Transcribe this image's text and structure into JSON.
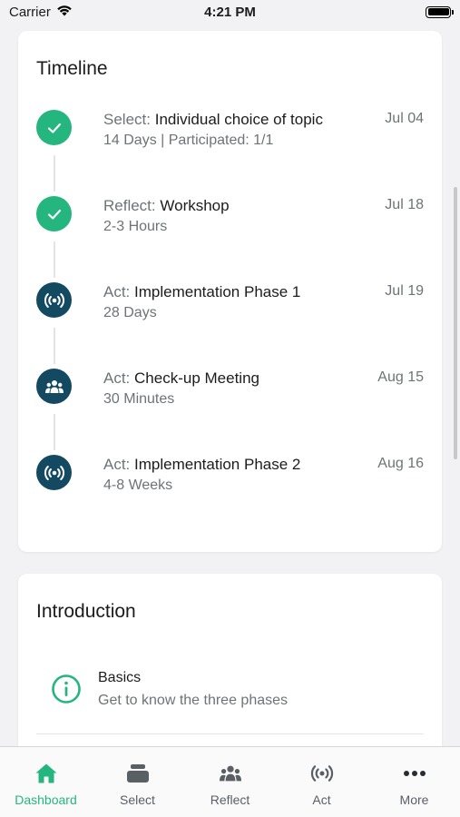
{
  "status_bar": {
    "carrier": "Carrier",
    "time": "4:21 PM"
  },
  "colors": {
    "accent": "#25b67f",
    "act": "#134a62",
    "muted": "#6e7378"
  },
  "timeline": {
    "title": "Timeline",
    "items": [
      {
        "phase": "Select:",
        "name": "Individual choice of topic",
        "sub": "14 Days | Participated: 1/1",
        "date": "Jul 04",
        "icon": "check-icon",
        "state": "done"
      },
      {
        "phase": "Reflect:",
        "name": "Workshop",
        "sub": "2-3 Hours",
        "date": "Jul 18",
        "icon": "check-icon",
        "state": "done"
      },
      {
        "phase": "Act:",
        "name": "Implementation Phase 1",
        "sub": "28 Days",
        "date": "Jul 19",
        "icon": "broadcast-icon",
        "state": "act"
      },
      {
        "phase": "Act:",
        "name": "Check-up Meeting",
        "sub": "30 Minutes",
        "date": "Aug 15",
        "icon": "group-icon",
        "state": "act"
      },
      {
        "phase": "Act:",
        "name": "Implementation Phase 2",
        "sub": "4-8 Weeks",
        "date": "Aug 16",
        "icon": "broadcast-icon",
        "state": "act"
      }
    ]
  },
  "introduction": {
    "title": "Introduction",
    "items": [
      {
        "title": "Basics",
        "sub": "Get to know the three phases",
        "icon": "info-icon"
      }
    ]
  },
  "tabbar": {
    "tabs": [
      {
        "label": "Dashboard",
        "icon": "home-icon",
        "active": true
      },
      {
        "label": "Select",
        "icon": "stack-icon",
        "active": false
      },
      {
        "label": "Reflect",
        "icon": "group-icon",
        "active": false
      },
      {
        "label": "Act",
        "icon": "broadcast-icon",
        "active": false
      },
      {
        "label": "More",
        "icon": "more-icon",
        "active": false
      }
    ]
  }
}
